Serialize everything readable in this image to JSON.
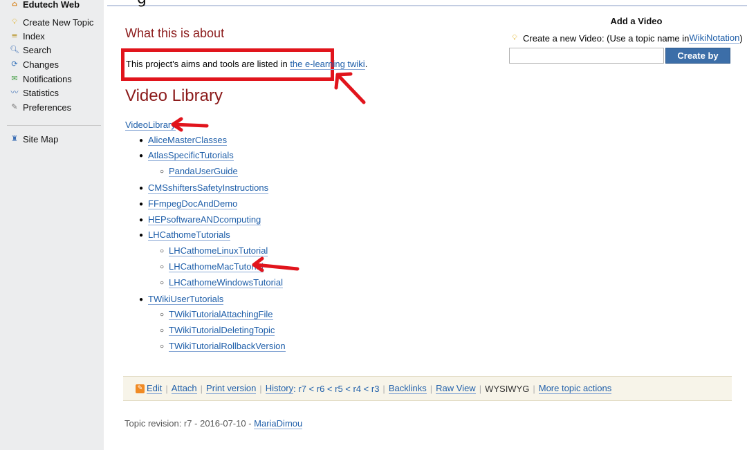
{
  "overlay": {
    "top_glyph": "g"
  },
  "sidebar": {
    "web": "Edutech Web",
    "items": [
      {
        "label": "Create New Topic",
        "icon": "lightbulb-icon"
      },
      {
        "label": "Index",
        "icon": "index-icon"
      },
      {
        "label": "Search",
        "icon": "search-icon"
      },
      {
        "label": "Changes",
        "icon": "changes-icon"
      },
      {
        "label": "Notifications",
        "icon": "notifications-icon"
      },
      {
        "label": "Statistics",
        "icon": "statistics-icon"
      },
      {
        "label": "Preferences",
        "icon": "preferences-icon"
      }
    ],
    "site_map": "Site Map"
  },
  "main": {
    "title": "What this is about",
    "about_prefix": "This project's aims and tools are listed in ",
    "about_link": "the e-learning twiki",
    "about_suffix": ".",
    "library_heading": "Video Library",
    "tree": {
      "root": "VideoLibrary",
      "items": [
        {
          "label": "AliceMasterClasses"
        },
        {
          "label": "AtlasSpecificTutorials",
          "children": [
            "PandaUserGuide"
          ]
        },
        {
          "label": "CMSshiftersSafetyInstructions"
        },
        {
          "label": "FFmpegDocAndDemo"
        },
        {
          "label": "HEPsoftwareANDcomputing"
        },
        {
          "label": "LHCathomeTutorials",
          "children": [
            "LHCathomeLinuxTutorial",
            "LHCathomeMacTutorial",
            "LHCathomeWindowsTutorial"
          ]
        },
        {
          "label": "TWikiUserTutorials",
          "children": [
            "TWikiTutorialAttachingFile",
            "TWikiTutorialDeletingTopic",
            "TWikiTutorialRollbackVersion"
          ]
        }
      ]
    }
  },
  "add_video": {
    "title": "Add a Video",
    "desc_prefix": "Create a new Video: (Use a topic name in ",
    "desc_link": "WikiNotation",
    "desc_suffix": ")",
    "input_value": "",
    "button": "Create by Name"
  },
  "actions": {
    "edit": "Edit",
    "attach": "Attach",
    "print": "Print version",
    "history_label": "History",
    "history_versions": ": r7 < r6 < r5 < r4 < r3",
    "backlinks": "Backlinks",
    "raw_view": "Raw View",
    "wysiwyg": "WYSIWYG",
    "more": "More topic actions"
  },
  "revision": {
    "prefix": "Topic revision: r7 - 2016-07-10 - ",
    "author": "MariaDimou"
  },
  "colors": {
    "heading": "#8b1a1a",
    "link": "#1e5ea9",
    "annotation": "#e1141c",
    "button": "#3c6ea8"
  }
}
